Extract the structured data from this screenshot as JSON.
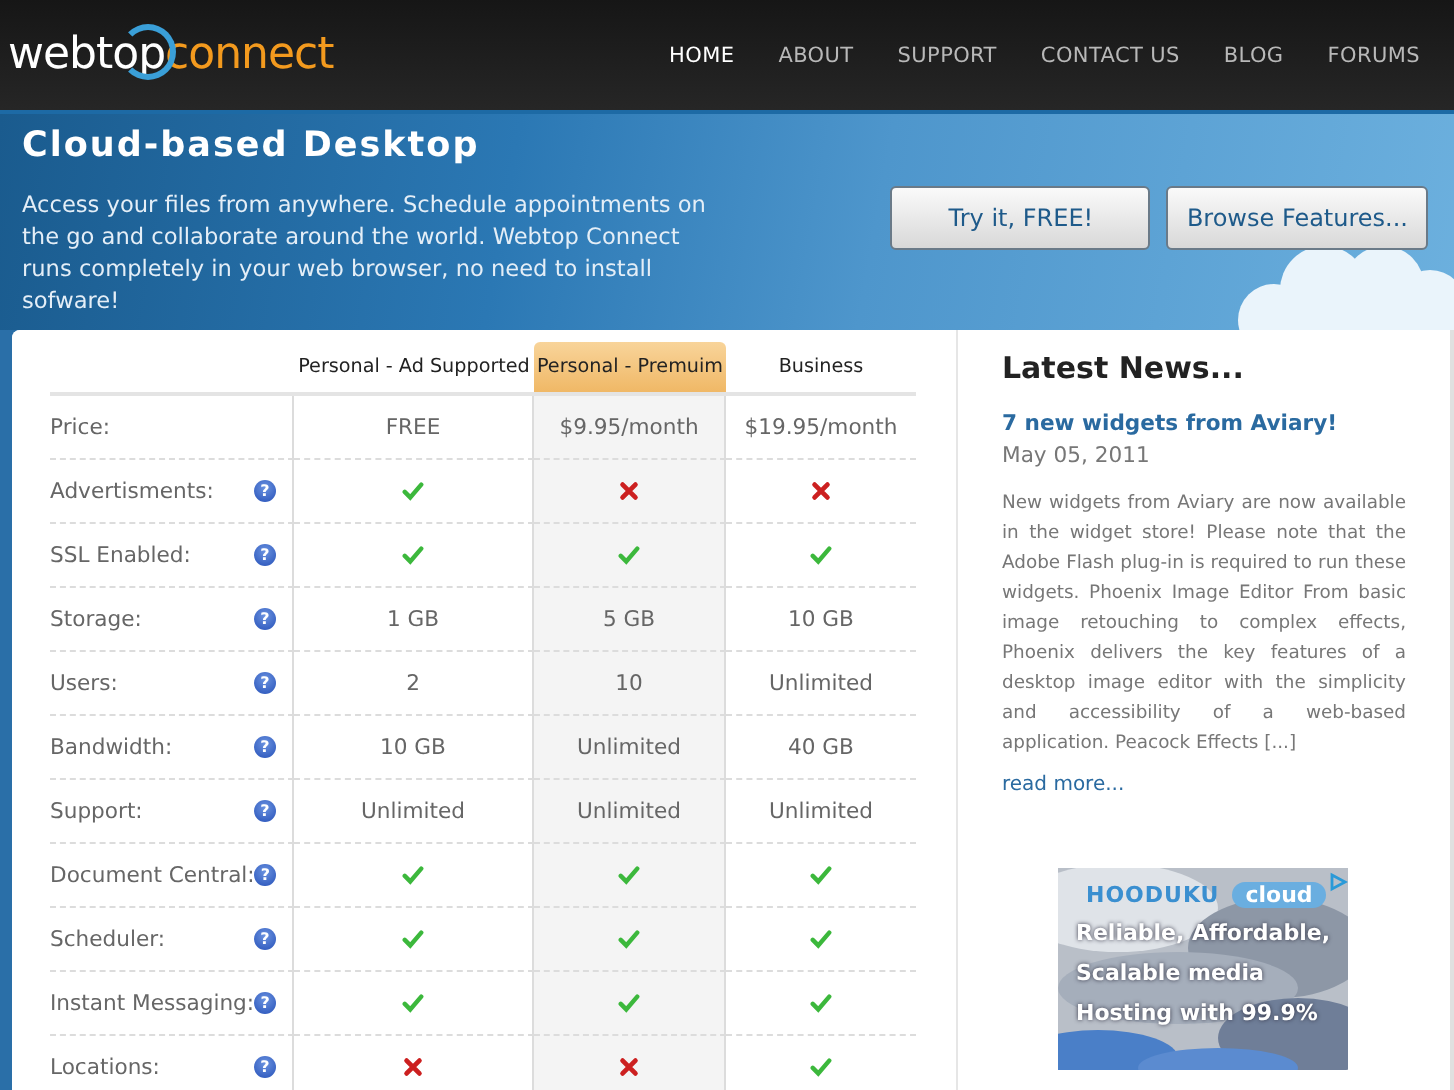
{
  "header": {
    "logo": {
      "part_1": "webtop",
      "part_2": "connect"
    },
    "nav": [
      {
        "label": "HOME",
        "selected": true
      },
      {
        "label": "ABOUT",
        "selected": false
      },
      {
        "label": "SUPPORT",
        "selected": false
      },
      {
        "label": "CONTACT US",
        "selected": false
      },
      {
        "label": "BLOG",
        "selected": false
      },
      {
        "label": "FORUMS",
        "selected": false
      }
    ]
  },
  "hero": {
    "title": "Cloud-based Desktop",
    "text": "Access your files from anywhere. Schedule appointments on the go and collaborate around the world. Webtop Connect runs completely in your web browser, no need to install sofware!",
    "buttons": [
      "Try it, FREE!",
      "Browse Features..."
    ]
  },
  "pricing": {
    "columns": [
      {
        "label": "Personal - Ad Supported",
        "highlighted": false
      },
      {
        "label": "Personal - Premuim",
        "highlighted": true
      },
      {
        "label": "Business",
        "highlighted": false
      }
    ],
    "rows": [
      {
        "label": "Price:",
        "cells": [
          {
            "kind": "text",
            "text": "FREE"
          },
          {
            "kind": "text",
            "text": "$9.95/month"
          },
          {
            "kind": "text",
            "text": "$19.95/month"
          }
        ]
      },
      {
        "label": "Advertisments:",
        "help": "?",
        "cells": [
          {
            "kind": "check"
          },
          {
            "kind": "cross"
          },
          {
            "kind": "cross"
          }
        ]
      },
      {
        "label": "SSL Enabled:",
        "help": "?",
        "cells": [
          {
            "kind": "check"
          },
          {
            "kind": "check"
          },
          {
            "kind": "check"
          }
        ]
      },
      {
        "label": "Storage:",
        "help": "?",
        "cells": [
          {
            "kind": "text",
            "text": "1 GB"
          },
          {
            "kind": "text",
            "text": "5 GB"
          },
          {
            "kind": "text",
            "text": "10 GB"
          }
        ]
      },
      {
        "label": "Users:",
        "help": "?",
        "cells": [
          {
            "kind": "text",
            "text": "2"
          },
          {
            "kind": "text",
            "text": "10"
          },
          {
            "kind": "text",
            "text": "Unlimited"
          }
        ]
      },
      {
        "label": "Bandwidth:",
        "help": "?",
        "cells": [
          {
            "kind": "text",
            "text": "10 GB"
          },
          {
            "kind": "text",
            "text": "Unlimited"
          },
          {
            "kind": "text",
            "text": "40 GB"
          }
        ]
      },
      {
        "label": "Support:",
        "help": "?",
        "cells": [
          {
            "kind": "text",
            "text": "Unlimited"
          },
          {
            "kind": "text",
            "text": "Unlimited"
          },
          {
            "kind": "text",
            "text": "Unlimited"
          }
        ]
      },
      {
        "label": "Document Central:",
        "help": "?",
        "cells": [
          {
            "kind": "check"
          },
          {
            "kind": "check"
          },
          {
            "kind": "check"
          }
        ]
      },
      {
        "label": "Scheduler:",
        "help": "?",
        "cells": [
          {
            "kind": "check"
          },
          {
            "kind": "check"
          },
          {
            "kind": "check"
          }
        ]
      },
      {
        "label": "Instant Messaging:",
        "help": "?",
        "cells": [
          {
            "kind": "check"
          },
          {
            "kind": "check"
          },
          {
            "kind": "check"
          }
        ]
      },
      {
        "label": "Locations:",
        "help": "?",
        "cells": [
          {
            "kind": "cross"
          },
          {
            "kind": "cross"
          },
          {
            "kind": "check"
          }
        ]
      }
    ]
  },
  "news": {
    "heading": "Latest News...",
    "items": [
      {
        "title": "7 new widgets from Aviary!",
        "date": "May 05, 2011",
        "text": "New widgets from Aviary are now available in the widget store! Please note that the Adobe Flash plug-in is required to run these widgets. Phoenix Image Editor From basic image retouching to complex effects, Phoenix delivers the key features of a desktop image editor with the simplicity and accessibility of a web-based application. Peacock Effects [...]",
        "link": "read more..."
      }
    ]
  },
  "ad": {
    "brand": "HOODUKU",
    "badge": "cloud",
    "lines": [
      "Reliable, Affordable,",
      "Scalable media",
      "Hosting with 99.9%"
    ]
  }
}
